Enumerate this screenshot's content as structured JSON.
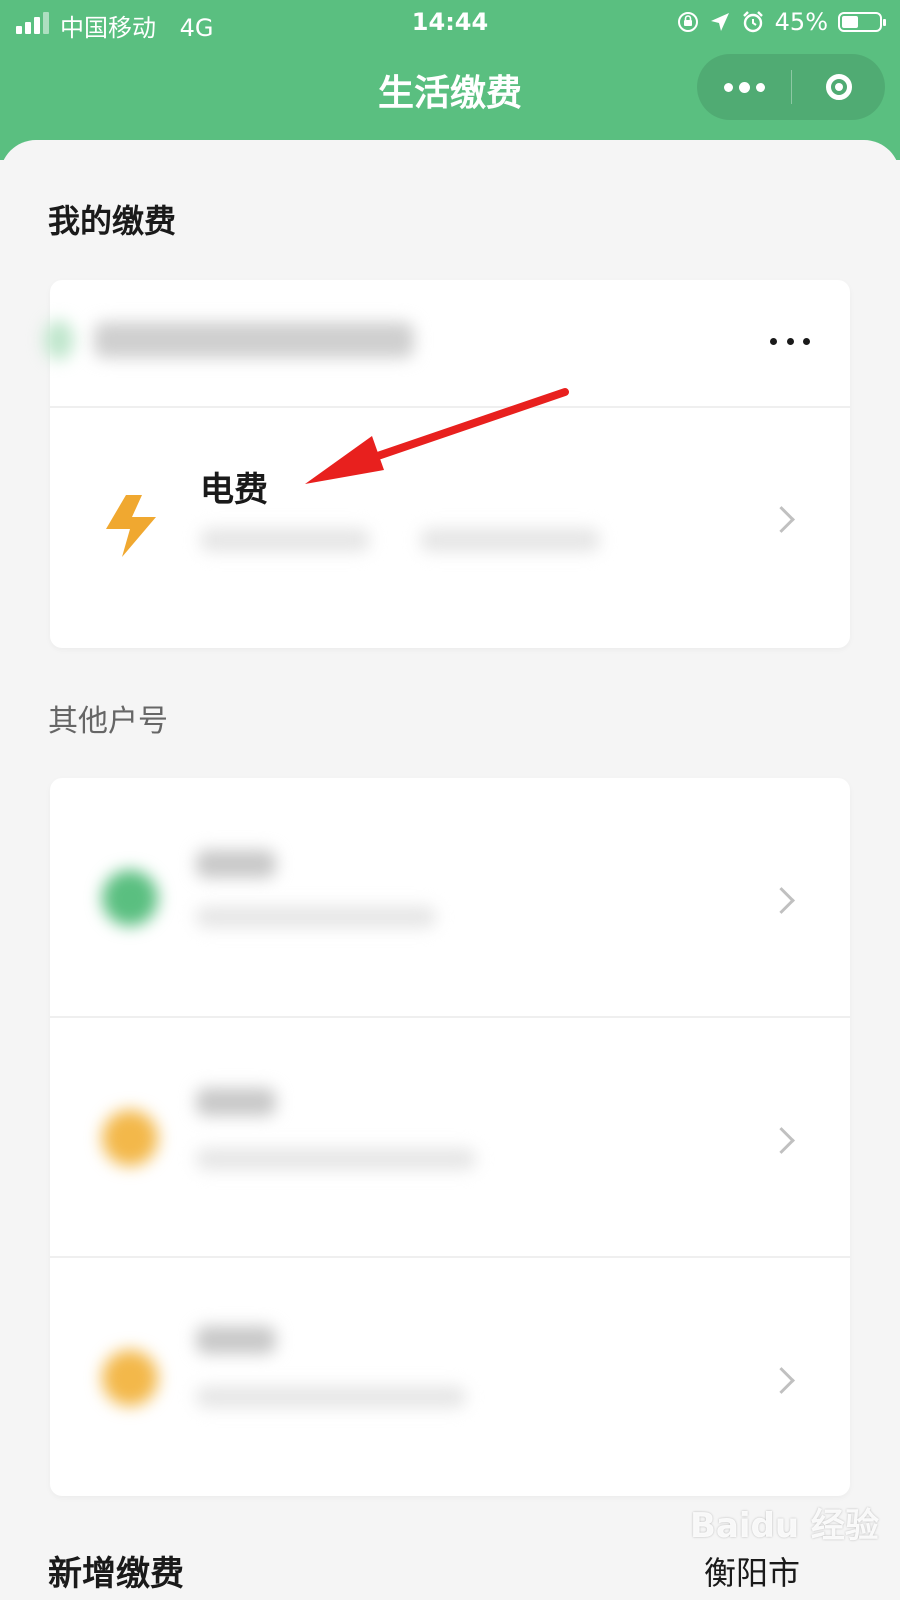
{
  "status_bar": {
    "carrier": "中国移动",
    "network": "4G",
    "time": "14:44",
    "battery": "45%",
    "battery_level": 0.45
  },
  "nav": {
    "title": "生活缴费",
    "more_icon": "more-dots-icon",
    "close_icon": "target-circle-icon"
  },
  "my_payments": {
    "title": "我的缴费",
    "item": {
      "name": "电费",
      "icon": "lightning-bolt-icon",
      "icon_color": "#f0a830"
    }
  },
  "other_accounts": {
    "title": "其他户号",
    "item_icon_colors": [
      "#5abf80",
      "#f3b84a",
      "#f3b84a"
    ]
  },
  "new_payment": {
    "title": "新增缴费",
    "city": "衡阳市"
  },
  "watermark": "Baidu 经验",
  "colors": {
    "brand_green": "#5abf80",
    "annotation_arrow": "#e8201e"
  }
}
